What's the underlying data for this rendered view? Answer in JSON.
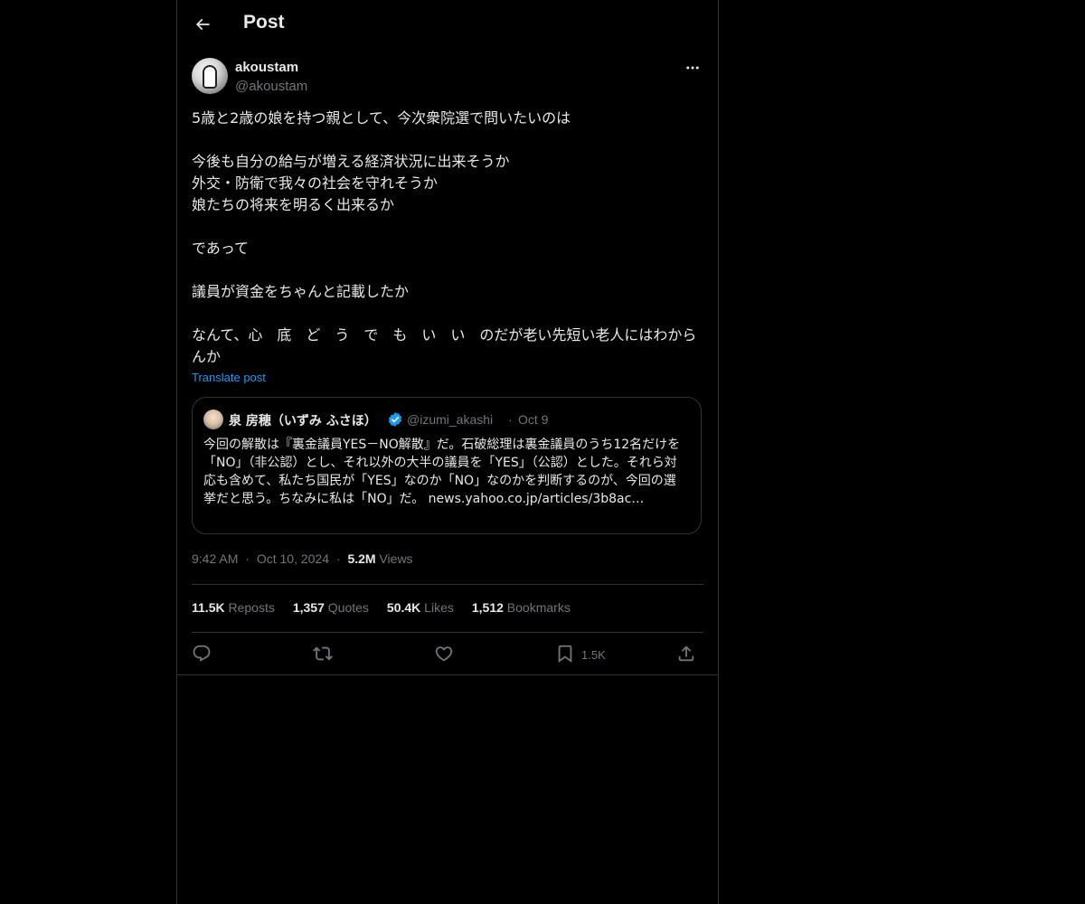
{
  "header": {
    "title": "Post"
  },
  "post": {
    "author_name": "akoustam",
    "author_handle": "@akoustam",
    "body": "5歳と2歳の娘を持つ親として、今次衆院選で問いたいのは\n\n今後も自分の給与が増える経済状況に出来そうか\n外交・防衛で我々の社会を守れそうか\n娘たちの将来を明るく出来るか\n\nであって\n\n議員が資金をちゃんと記載したか\n\nなんて、心　底　ど　う　で　も　い　い　のだが老い先短い老人にはわからんか",
    "translate_label": "Translate post",
    "time": "9:42 AM",
    "date": "Oct 10, 2024",
    "views_count": "5.2M",
    "views_label": "Views",
    "separator": "·"
  },
  "quote": {
    "author_name": "泉 房穂（いずみ ふさほ）",
    "author_handle": "@izumi_akashi",
    "separator": "·",
    "date": "Oct 9",
    "text": "今回の解散は『裏金議員YES－NO解散』だ。石破総理は裏金議員のうち12名だけを「NO」（非公認）とし、それ以外の大半の議員を「YES」（公認）とした。それら対応も含めて、私たち国民が「YES」なのか「NO」なのかを判断するのが、今回の選挙だと思う。ちなみに私は「NO」だ。 news.yahoo.co.jp/articles/3b8ac…"
  },
  "stats": {
    "reposts_count": "11.5K",
    "reposts_label": "Reposts",
    "quotes_count": "1,357",
    "quotes_label": "Quotes",
    "likes_count": "50.4K",
    "likes_label": "Likes",
    "bookmarks_count": "1,512",
    "bookmarks_label": "Bookmarks"
  },
  "actions": {
    "bookmark_count": "1.5K"
  },
  "colors": {
    "background": "#000000",
    "text": "#e7e9ea",
    "muted": "#71767b",
    "border": "#2f3336",
    "link": "#1d9bf0"
  },
  "icons": [
    "back-arrow-icon",
    "more-icon",
    "verified-icon",
    "reply-icon",
    "repost-icon",
    "like-icon",
    "bookmark-icon",
    "share-icon"
  ]
}
